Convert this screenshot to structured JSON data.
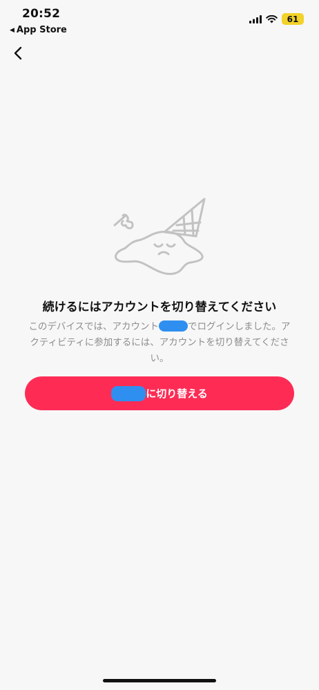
{
  "status_bar": {
    "time": "20:52",
    "back_app": "App Store",
    "battery": "61",
    "icons": [
      "signal-icon",
      "wifi-icon",
      "battery-icon"
    ],
    "battery_color": "#f2d22b"
  },
  "nav": {
    "back_icon": "chevron-left-icon"
  },
  "content": {
    "illustration": "melted-ice-cream-illustration",
    "title": "続けるにはアカウントを切り替えてください",
    "desc_part1": "このデバイスでは、アカウント",
    "desc_part2": "でログインしました。アクティビティに参加するには、アカウントを切り替えてください。"
  },
  "switch_button": {
    "label": "に切り替える",
    "color": "#fe2c55"
  }
}
